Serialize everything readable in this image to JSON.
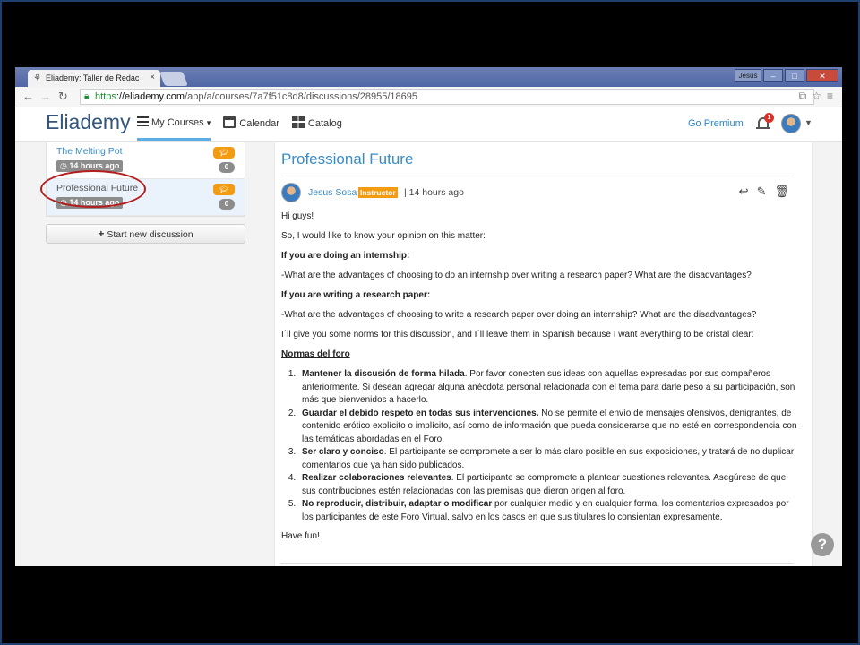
{
  "browser": {
    "tab_title": "Eliademy: Taller de Redac",
    "tab_close": "×",
    "user_button": "Jesus",
    "url_https": "https",
    "url_host": "://eliademy.com",
    "url_path": "/app/a/courses/7a7f51c8d8/discussions/28955/18695"
  },
  "header": {
    "logo": "Eliademy",
    "menu": [
      {
        "label": "My Courses",
        "icon": "hamburger-icon",
        "active": true
      },
      {
        "label": "Calendar",
        "icon": "calendar-icon"
      },
      {
        "label": "Catalog",
        "icon": "grid-icon"
      }
    ],
    "go_premium": "Go Premium",
    "notif_count": "1"
  },
  "sidebar": {
    "discussions": [
      {
        "title": "The Melting Pot",
        "time": "14 hours ago",
        "count": "0"
      },
      {
        "title": "Professional Future",
        "time": "14 hours ago",
        "count": "0"
      }
    ],
    "new_discussion": "Start new discussion"
  },
  "discussion": {
    "title": "Professional Future",
    "author": "Jesus Sosa",
    "role": "Instructor",
    "time": "| 14 hours ago",
    "p1": "Hi guys!",
    "p2": "So, I would like to know your opinion on this matter:",
    "h1": "If you are doing an internship:",
    "p3": "-What are the advantages of choosing to do an internship over writing a research paper? What are the disadvantages?",
    "h2": "If you are writing a research paper:",
    "p4": "-What are the advantages of choosing to write a research paper over doing an internship? What are the disadvantages?",
    "p5": "I´ll give you some norms for this discussion, and I´ll leave them in Spanish because I want everything to be cristal clear:",
    "rules_title": "Normas del foro",
    "rules": [
      {
        "bold": "Mantener la discusión de forma hilada",
        "text": ". Por favor conecten sus ideas con aquellas expresadas por sus compañeros anteriormente. Si desean agregar alguna anécdota personal relacionada con el tema para darle peso a su participación, son más que bienvenidos a hacerlo."
      },
      {
        "bold": "Guardar el debido respeto en todas sus intervenciones.",
        "text": " No se permite el envío de mensajes ofensivos, denigrantes, de contenido erótico explícito o implícito, así como de información que pueda considerarse que no esté en correspondencia con las temáticas abordadas en el Foro."
      },
      {
        "bold": "Ser claro y conciso",
        "text": ". El participante se compromete a ser lo más claro posible en sus exposiciones, y tratará de no duplicar comentarios que ya han sido publicados."
      },
      {
        "bold": "Realizar colaboraciones relevantes",
        "text": ". El participante se compromete a plantear cuestiones relevantes. Asegúrese de que sus contribuciones estén relacionadas con las premisas que dieron origen al foro."
      },
      {
        "bold": "No reproducir, distribuir, adaptar o modificar",
        "text": " por cualquier medio y en cualquier forma, los comentarios expresados por los participantes de este Foro Virtual, salvo en los casos en que sus titulares lo consientan expresamente."
      }
    ],
    "closing": "Have fun!"
  },
  "help_label": "?"
}
